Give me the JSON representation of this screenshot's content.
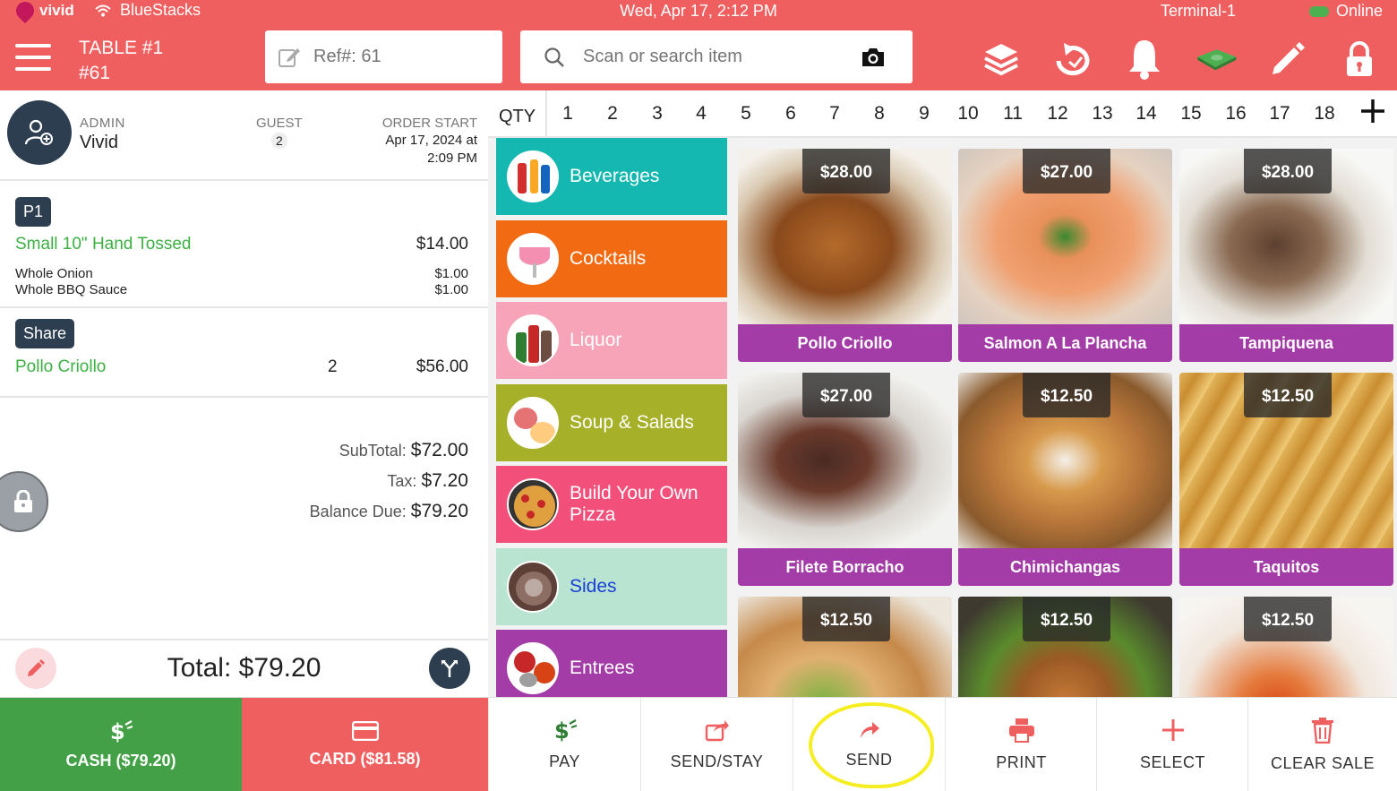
{
  "statusbar": {
    "brand": "vivid",
    "app": "BlueStacks",
    "datetime": "Wed, Apr 17, 2:12 PM",
    "terminal": "Terminal-1",
    "connection": "Online"
  },
  "header": {
    "table_title": "TABLE #1",
    "table_sub": "#61",
    "ref_placeholder": "Ref#: 61",
    "search_placeholder": "Scan or search item",
    "icons": [
      "layers-icon",
      "refresh-icon",
      "bell-icon",
      "cash-drawer-icon",
      "pencil-icon",
      "lock-icon"
    ]
  },
  "order": {
    "admin_label": "ADMIN",
    "admin_name": "Vivid",
    "guest_label": "GUEST",
    "guest_count": "2",
    "start_label": "ORDER START",
    "start_date": "Apr 17, 2024 at",
    "start_time": "2:09 PM",
    "items": [
      {
        "chip": "P1",
        "name": "Small 10\" Hand Tossed",
        "price": "$14.00",
        "mods": [
          {
            "name": "Whole Onion",
            "price": "$1.00"
          },
          {
            "name": "Whole BBQ Sauce",
            "price": "$1.00"
          }
        ]
      },
      {
        "chip": "Share",
        "name": "Pollo Criollo",
        "qty": "2",
        "price": "$56.00"
      }
    ],
    "subtotal_label": "SubTotal:",
    "subtotal": "$72.00",
    "tax_label": "Tax:",
    "tax": "$7.20",
    "balance_label": "Balance Due:",
    "balance": "$79.20",
    "total": "Total: $79.20"
  },
  "qtybar": {
    "label": "QTY",
    "numbers": [
      "1",
      "2",
      "3",
      "4",
      "5",
      "6",
      "7",
      "8",
      "9",
      "10",
      "11",
      "12",
      "13",
      "14",
      "15",
      "16",
      "17",
      "18"
    ]
  },
  "categories": [
    {
      "label": "Beverages",
      "color": "#14b8b0"
    },
    {
      "label": "Cocktails",
      "color": "#f26a12"
    },
    {
      "label": "Liquor",
      "color": "#f7a3b8"
    },
    {
      "label": "Soup & Salads",
      "color": "#a6b129"
    },
    {
      "label": "Build Your Own Pizza",
      "color": "#f2507a"
    },
    {
      "label": "Sides",
      "color": "#b8e4d1",
      "text_color": "#1a3fd6"
    },
    {
      "label": "Entrees",
      "color": "#a43ca8"
    }
  ],
  "products": [
    {
      "name": "Pollo Criollo",
      "price": "$28.00"
    },
    {
      "name": "Salmon A La Plancha",
      "price": "$27.00"
    },
    {
      "name": "Tampiquena",
      "price": "$28.00"
    },
    {
      "name": "Filete Borracho",
      "price": "$27.00"
    },
    {
      "name": "Chimichangas",
      "price": "$12.50"
    },
    {
      "name": "Taquitos",
      "price": "$12.50"
    },
    {
      "name": "",
      "price": "$12.50"
    },
    {
      "name": "",
      "price": "$12.50"
    },
    {
      "name": "",
      "price": "$12.50"
    }
  ],
  "bottom": {
    "cash": "CASH ($79.20)",
    "card": "CARD ($81.58)",
    "pay": "PAY",
    "send_stay": "SEND/STAY",
    "send": "SEND",
    "print": "PRINT",
    "select": "SELECT",
    "clear": "CLEAR SALE"
  },
  "colors": {
    "brand_red": "#f05f5f",
    "cash_green": "#43a047",
    "navy": "#2c3e50",
    "product_purple": "#a43ca8",
    "item_green": "#3cb043",
    "highlight_yellow": "#f5ee22"
  }
}
